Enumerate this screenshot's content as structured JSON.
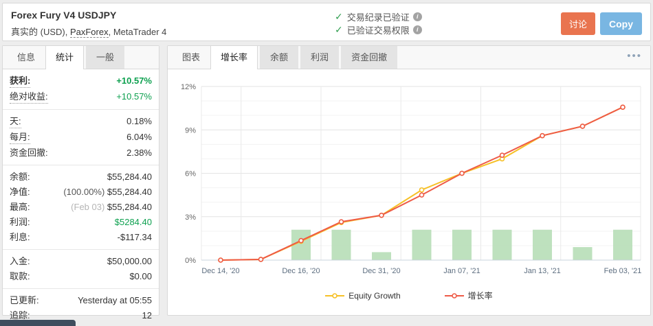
{
  "colors": {
    "green_text": "#0da04f",
    "check_green": "#2f9e4f",
    "discuss_orange": "#e9744f",
    "copy_blue": "#79b6e2",
    "bar_green": "#b3dcb3",
    "equity_yellow": "#f6c026",
    "growth_red": "#ee5a46"
  },
  "icons": {
    "check": "✓",
    "info": "i",
    "more_menu": "•••"
  },
  "header": {
    "title": "Forex Fury V4 USDJPY",
    "account_type": "真实的 (USD),",
    "broker": "PaxForex",
    "platform": ", MetaTrader 4",
    "verifications": [
      "交易纪录已验证",
      "已验证交易权限"
    ],
    "discuss_label": "讨论",
    "copy_label": "Copy"
  },
  "stats_panel": {
    "tabs": [
      {
        "key": "info",
        "label": "信息",
        "active": false,
        "gray": false
      },
      {
        "key": "statistics",
        "label": "统计",
        "active": true,
        "gray": false
      },
      {
        "key": "general",
        "label": "一般",
        "active": false,
        "gray": true
      }
    ],
    "groups": [
      {
        "rows": [
          {
            "key": "gain",
            "label": "获利:",
            "value": "+10.57%",
            "bold": true,
            "dotted": true,
            "green": true
          },
          {
            "key": "abs-gain",
            "label": "绝对收益:",
            "value": "+10.57%",
            "dotted": true,
            "green": true
          }
        ]
      },
      {
        "rows": [
          {
            "key": "daily",
            "label": "天:",
            "value": "0.18%",
            "dotted": true
          },
          {
            "key": "monthly",
            "label": "每月:",
            "value": "6.04%",
            "dotted": true
          },
          {
            "key": "drawdown",
            "label": "资金回撤:",
            "value": "2.38%"
          }
        ]
      },
      {
        "rows": [
          {
            "key": "balance",
            "label": "余额:",
            "value": "$55,284.40"
          },
          {
            "key": "equity",
            "label": "净值:",
            "prefix": "(100.00%) ",
            "prefix_light": false,
            "value": "$55,284.40"
          },
          {
            "key": "highest",
            "label": "最高:",
            "prefix": "(Feb 03) ",
            "prefix_light": true,
            "value": "$55,284.40"
          },
          {
            "key": "profit",
            "label": "利润:",
            "value": "$5284.40",
            "green": true
          },
          {
            "key": "interest",
            "label": "利息:",
            "value": "-$117.34"
          }
        ]
      },
      {
        "rows": [
          {
            "key": "deposits",
            "label": "入金:",
            "value": "$50,000.00"
          },
          {
            "key": "withdrawals",
            "label": "取款:",
            "value": "$0.00"
          }
        ]
      },
      {
        "rows": [
          {
            "key": "updated",
            "label": "已更新:",
            "value": "Yesterday at 05:55"
          },
          {
            "key": "tracking",
            "label": "追踪:",
            "value": "12"
          }
        ]
      }
    ]
  },
  "chart_panel": {
    "tabs": [
      {
        "key": "chart",
        "label": "图表",
        "active": false,
        "gray": false
      },
      {
        "key": "growth",
        "label": "增长率",
        "active": true,
        "gray": false
      },
      {
        "key": "balance",
        "label": "余额",
        "active": false,
        "gray": true
      },
      {
        "key": "profit",
        "label": "利润",
        "active": false,
        "gray": true
      },
      {
        "key": "drawdown",
        "label": "资金回撤",
        "active": false,
        "gray": true
      }
    ]
  },
  "chart_data": {
    "type": "line",
    "title": "",
    "ylim": [
      0,
      12
    ],
    "yticks": [
      0,
      3,
      6,
      9,
      12
    ],
    "ytick_suffix": "%",
    "grid": true,
    "legend_position": "bottom",
    "x_count": 11,
    "xticks": [
      {
        "i": 0,
        "label": "Dec 14, '20"
      },
      {
        "i": 2,
        "label": "Dec 16, '20"
      },
      {
        "i": 4,
        "label": "Dec 31, '20"
      },
      {
        "i": 6,
        "label": "Jan 07, '21"
      },
      {
        "i": 8,
        "label": "Jan 13, '21"
      },
      {
        "i": 10,
        "label": "Feb 03, '21"
      }
    ],
    "series": [
      {
        "name": "Equity Growth",
        "color": "#f6c026",
        "values": [
          0,
          0.05,
          1.3,
          2.6,
          3.1,
          4.85,
          6.0,
          7.0,
          8.6,
          9.25,
          10.57
        ]
      },
      {
        "name": "增长率",
        "color": "#ee5a46",
        "values": [
          0,
          0.05,
          1.35,
          2.65,
          3.1,
          4.5,
          6.0,
          7.25,
          8.6,
          9.25,
          10.57
        ]
      }
    ],
    "bars": {
      "color": "#b3dcb3",
      "values": [
        0,
        0,
        2.1,
        2.1,
        0.55,
        2.1,
        2.1,
        2.1,
        2.1,
        0.9,
        2.1
      ]
    }
  }
}
